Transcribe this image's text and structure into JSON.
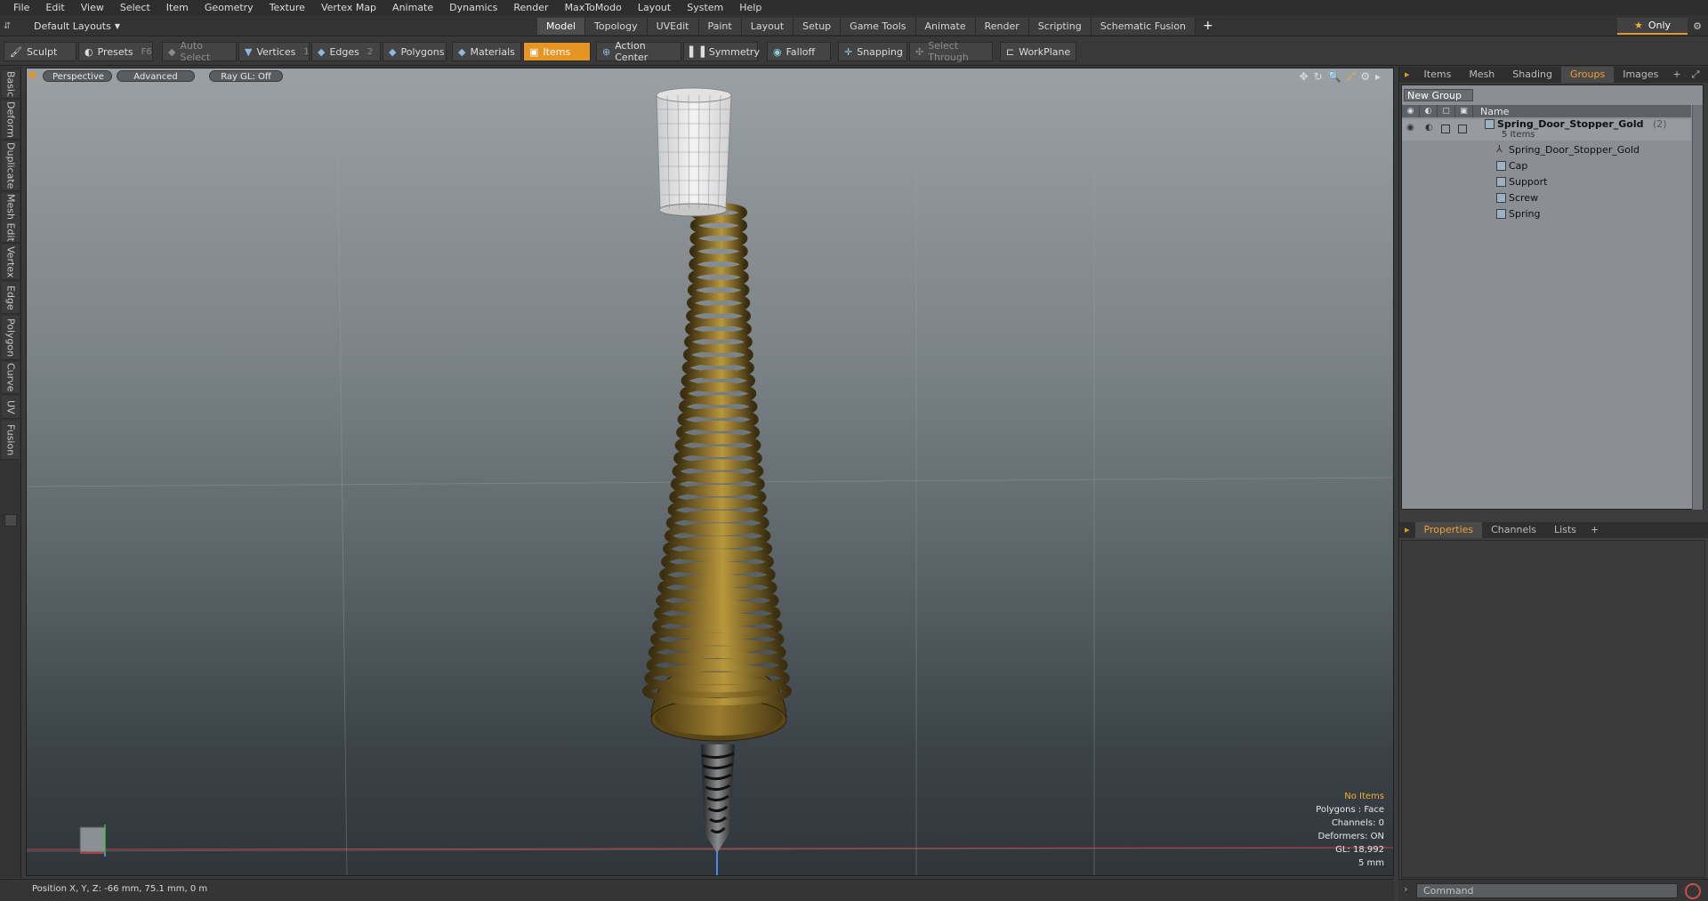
{
  "menubar": {
    "items": [
      "File",
      "Edit",
      "View",
      "Select",
      "Item",
      "Geometry",
      "Texture",
      "Vertex Map",
      "Animate",
      "Dynamics",
      "Render",
      "MaxToModo",
      "Layout",
      "System",
      "Help"
    ]
  },
  "modebar": {
    "layout_selector": "Default Layouts",
    "tabs": [
      "Model",
      "Topology",
      "UVEdit",
      "Paint",
      "Layout",
      "Setup",
      "Game Tools",
      "Animate",
      "Render",
      "Scripting",
      "Schematic Fusion"
    ],
    "active_tab": "Model",
    "only_label": "Only"
  },
  "toolbar": {
    "sculpt": "Sculpt",
    "presets": "Presets",
    "presets_key": "F6",
    "auto_select": "Auto Select",
    "vertices": "Vertices",
    "vertices_key": "1",
    "edges": "Edges",
    "edges_key": "2",
    "polygons": "Polygons",
    "materials": "Materials",
    "items": "Items",
    "action_center": "Action Center",
    "symmetry": "Symmetry",
    "falloff": "Falloff",
    "snapping": "Snapping",
    "select_through": "Select Through",
    "workplane": "WorkPlane"
  },
  "left_tabs": [
    "Basic",
    "Deform",
    "Duplicate",
    "Mesh Edit",
    "Vertex",
    "Edge",
    "Polygon",
    "Curve",
    "UV",
    "Fusion"
  ],
  "viewport": {
    "view_mode": "Perspective",
    "shading": "Advanced",
    "raygl": "Ray GL: Off",
    "info": {
      "selection": "No Items",
      "polygons": "Polygons : Face",
      "channels": "Channels: 0",
      "deformers": "Deformers: ON",
      "gl": "GL: 18,992",
      "grid": "5 mm"
    }
  },
  "groups_panel": {
    "tabs": [
      "Items",
      "Mesh ...",
      "Shading",
      "Groups",
      "Images"
    ],
    "active_tab": "Groups",
    "new_group": "New Group",
    "column_name": "Name",
    "root": {
      "name": "Spring_Door_Stopper_Gold",
      "count": "(2)",
      "sub": "5 Items"
    },
    "children": [
      "Spring_Door_Stopper_Gold",
      "Cap",
      "Support",
      "Screw",
      "Spring"
    ]
  },
  "properties_panel": {
    "tabs": [
      "Properties",
      "Channels",
      "Lists"
    ],
    "active_tab": "Properties"
  },
  "statusbar": {
    "position": "Position X, Y, Z:  -66 mm, 75.1 mm, 0 m"
  },
  "command": {
    "placeholder": "Command"
  },
  "colors": {
    "accent": "#e69524",
    "viewport_top": "#9aa0a3",
    "viewport_bottom": "#2f363b",
    "spring_gold": "#6b5520"
  }
}
